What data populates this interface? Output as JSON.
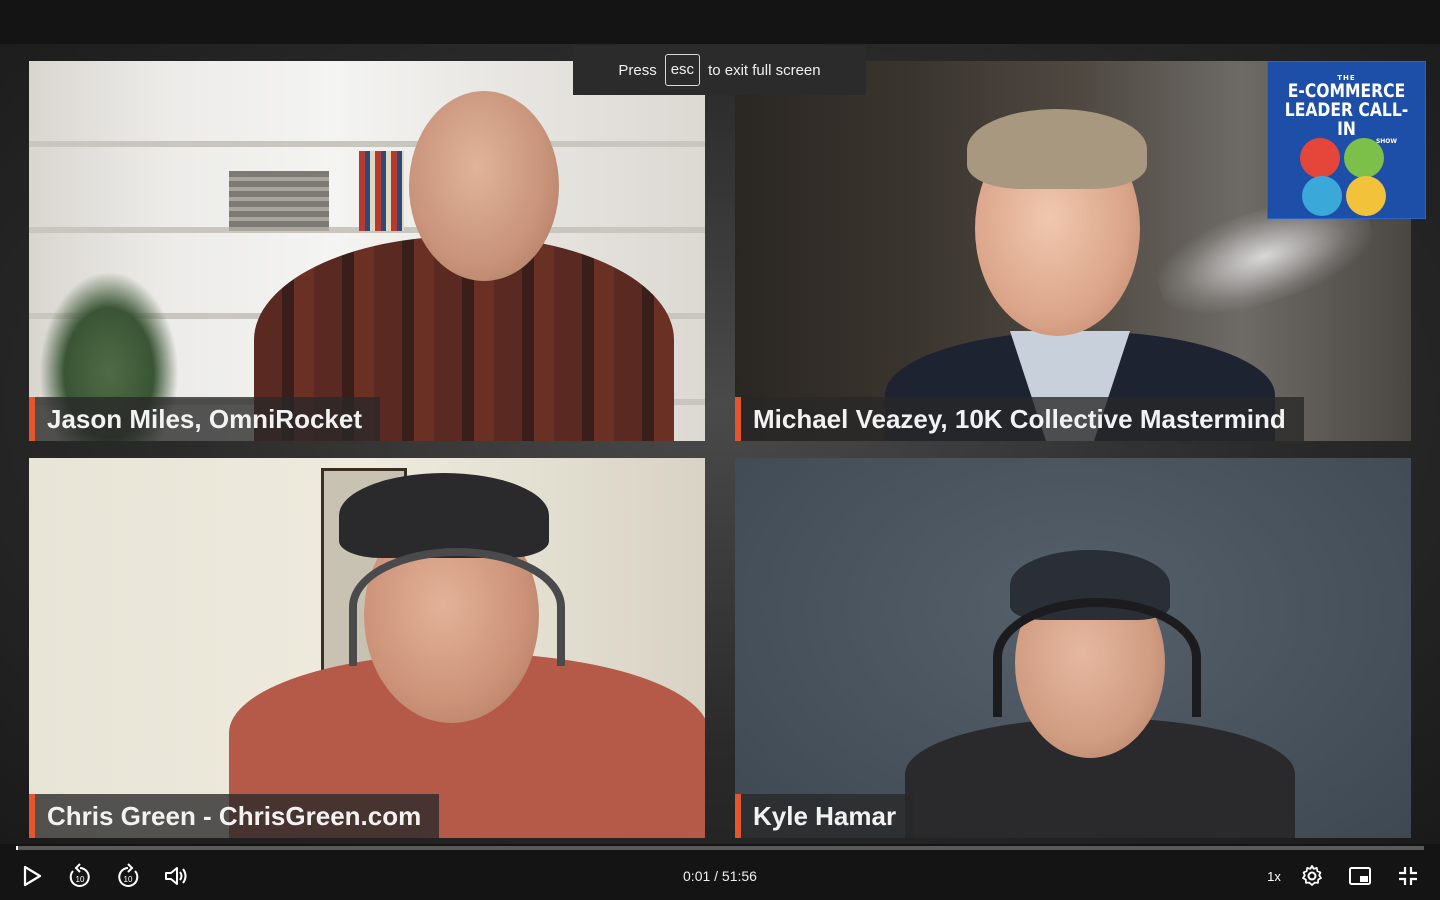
{
  "banner": {
    "press": "Press",
    "key": "esc",
    "suffix": "to exit full screen"
  },
  "logo": {
    "line1": "THE",
    "line2": "E-COMMERCE",
    "line3": "LEADER CALL-IN",
    "line4": "SHOW"
  },
  "participants": [
    {
      "name": "Jason Miles, OmniRocket"
    },
    {
      "name": "Michael Veazey, 10K Collective Mastermind"
    },
    {
      "name": "Chris Green - ChrisGreen.com"
    },
    {
      "name": "Kyle Hamar"
    }
  ],
  "player": {
    "current_time": "0:01",
    "duration": "51:56",
    "time_display": "0:01 / 51:56",
    "speed": "1x",
    "progress": 0.0003
  },
  "icons": {
    "play": "play-icon",
    "rewind": "rewind-10-icon",
    "forward": "forward-10-icon",
    "volume": "volume-icon",
    "settings": "gear-icon",
    "pip": "picture-in-picture-icon",
    "exit_fullscreen": "exit-fullscreen-icon"
  },
  "colors": {
    "accent": "#e4572e",
    "logo_bg": "#1d4fa8"
  }
}
